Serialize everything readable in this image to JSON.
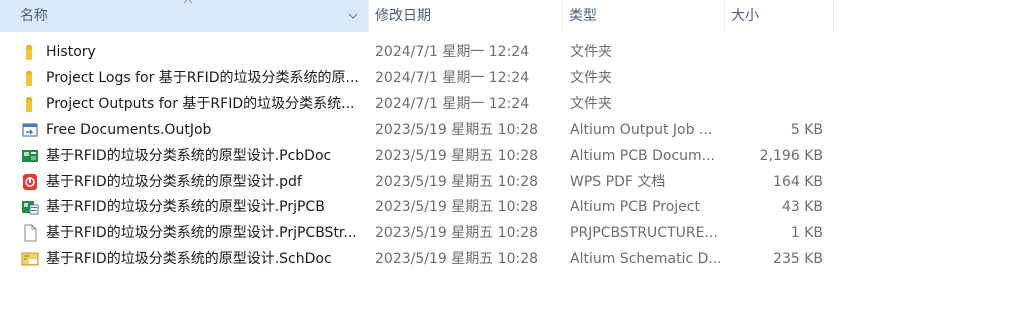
{
  "columns": {
    "name": "名称",
    "date": "修改日期",
    "type": "类型",
    "size": "大小"
  },
  "files": [
    {
      "icon": "folder-icon",
      "name": "History",
      "date": "2024/7/1 星期一 12:24",
      "type": "文件夹",
      "size": ""
    },
    {
      "icon": "folder-icon",
      "name": "Project Logs for 基于RFID的垃圾分类系统的原...",
      "date": "2024/7/1 星期一 12:24",
      "type": "文件夹",
      "size": ""
    },
    {
      "icon": "folder-icon",
      "name": "Project Outputs for 基于RFID的垃圾分类系统...",
      "date": "2024/7/1 星期一 12:24",
      "type": "文件夹",
      "size": ""
    },
    {
      "icon": "outjob-file-icon",
      "name": "Free Documents.OutJob",
      "date": "2023/5/19 星期五 10:28",
      "type": "Altium Output Job ...",
      "size": "5 KB"
    },
    {
      "icon": "pcbdoc-file-icon",
      "name": "基于RFID的垃圾分类系统的原型设计.PcbDoc",
      "date": "2023/5/19 星期五 10:28",
      "type": "Altium PCB Docum...",
      "size": "2,196 KB"
    },
    {
      "icon": "pdf-file-icon",
      "name": "基于RFID的垃圾分类系统的原型设计.pdf",
      "date": "2023/5/19 星期五 10:28",
      "type": "WPS PDF 文档",
      "size": "164 KB"
    },
    {
      "icon": "prjpcb-file-icon",
      "name": "基于RFID的垃圾分类系统的原型设计.PrjPCB",
      "date": "2023/5/19 星期五 10:28",
      "type": "Altium PCB Project",
      "size": "43 KB"
    },
    {
      "icon": "generic-file-icon",
      "name": "基于RFID的垃圾分类系统的原型设计.PrjPCBStr...",
      "date": "2023/5/19 星期五 10:28",
      "type": "PRJPCBSTRUCTURE...",
      "size": "1 KB"
    },
    {
      "icon": "schdoc-file-icon",
      "name": "基于RFID的垃圾分类系统的原型设计.SchDoc",
      "date": "2023/5/19 星期五 10:28",
      "type": "Altium Schematic D...",
      "size": "235 KB"
    }
  ]
}
